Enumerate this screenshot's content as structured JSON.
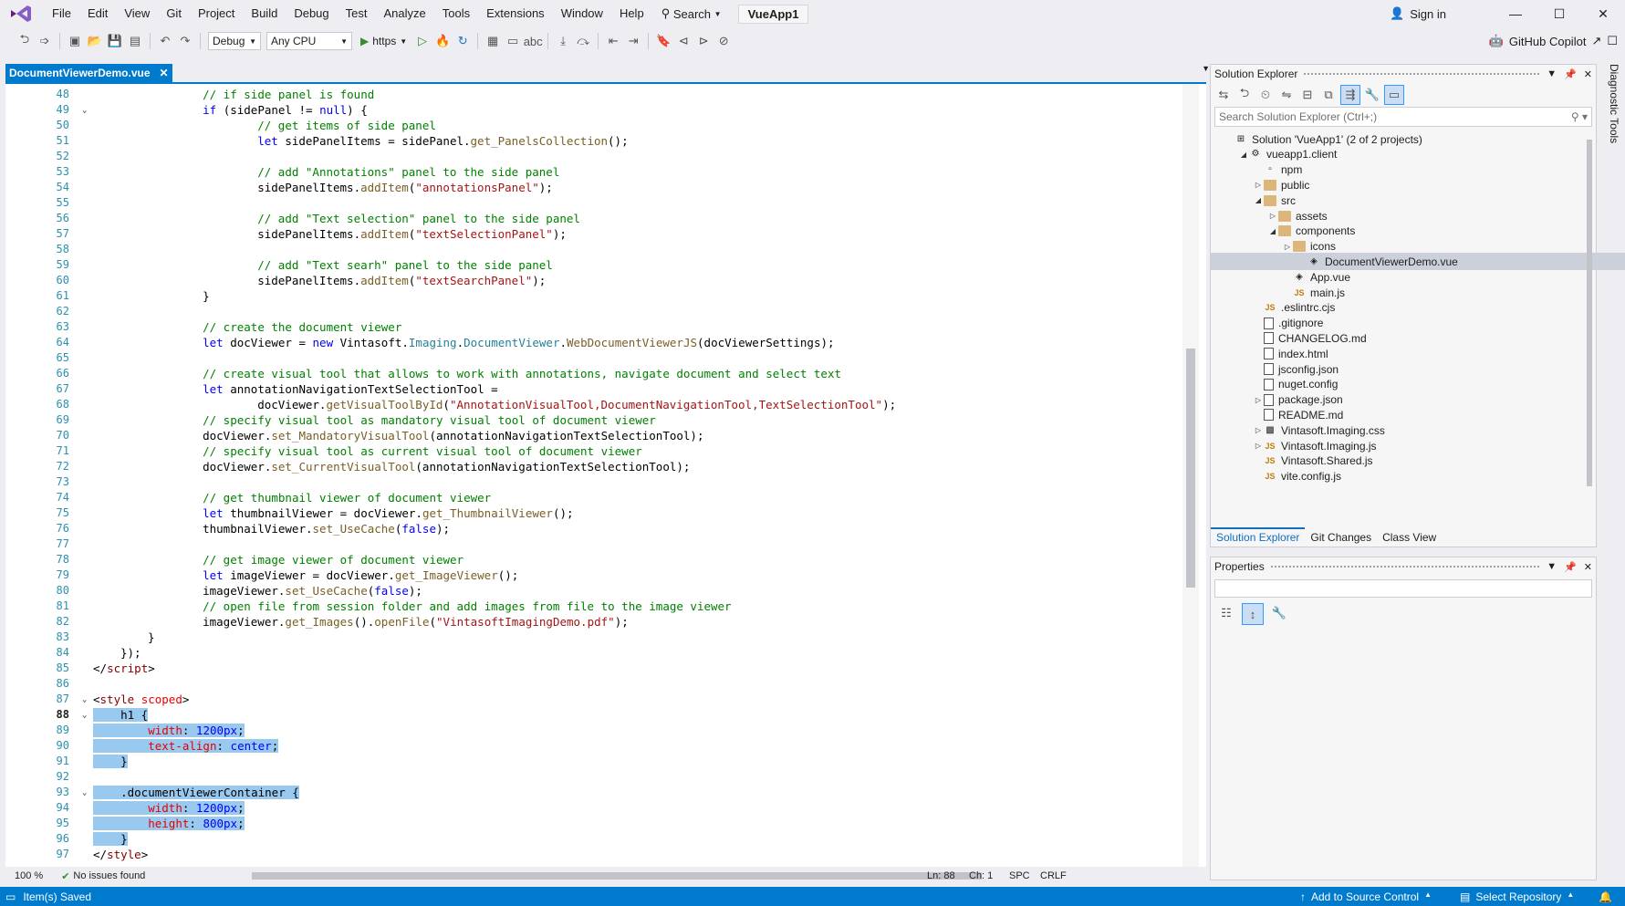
{
  "menu": [
    "File",
    "Edit",
    "View",
    "Git",
    "Project",
    "Build",
    "Debug",
    "Test",
    "Analyze",
    "Tools",
    "Extensions",
    "Window",
    "Help"
  ],
  "search_label": "Search",
  "solution_name": "VueApp1",
  "sign_in": "Sign in",
  "toolbar": {
    "config": "Debug",
    "platform": "Any CPU",
    "run_target": "https"
  },
  "copilot": "GitHub Copilot",
  "doc_tab": "DocumentViewerDemo.vue",
  "editor": {
    "zoom": "100 %",
    "issues": "No issues found",
    "ln": "Ln: 88",
    "ch": "Ch: 1",
    "spc": "SPC",
    "crlf": "CRLF",
    "line_numbers": [
      "48",
      "49",
      "50",
      "51",
      "52",
      "53",
      "54",
      "55",
      "56",
      "57",
      "58",
      "59",
      "60",
      "61",
      "62",
      "63",
      "64",
      "65",
      "66",
      "67",
      "68",
      "69",
      "70",
      "71",
      "72",
      "73",
      "74",
      "75",
      "76",
      "77",
      "78",
      "79",
      "80",
      "81",
      "82",
      "83",
      "84",
      "85",
      "86",
      "87",
      "88",
      "89",
      "90",
      "91",
      "92",
      "93",
      "94",
      "95",
      "96",
      "97"
    ]
  },
  "solution_explorer": {
    "title": "Solution Explorer",
    "search_placeholder": "Search Solution Explorer (Ctrl+;)",
    "items": [
      "Solution 'VueApp1' (2 of 2 projects)",
      "vueapp1.client",
      "npm",
      "public",
      "src",
      "assets",
      "components",
      "icons",
      "DocumentViewerDemo.vue",
      "App.vue",
      "main.js",
      ".eslintrc.cjs",
      ".gitignore",
      "CHANGELOG.md",
      "index.html",
      "jsconfig.json",
      "nuget.config",
      "package.json",
      "README.md",
      "Vintasoft.Imaging.css",
      "Vintasoft.Imaging.js",
      "Vintasoft.Shared.js",
      "vite.config.js"
    ],
    "tabs": [
      "Solution Explorer",
      "Git Changes",
      "Class View"
    ]
  },
  "properties": {
    "title": "Properties"
  },
  "diagnostic": "Diagnostic Tools",
  "status": {
    "left": "Item(s) Saved",
    "source_control": "Add to Source Control",
    "repo": "Select Repository"
  }
}
